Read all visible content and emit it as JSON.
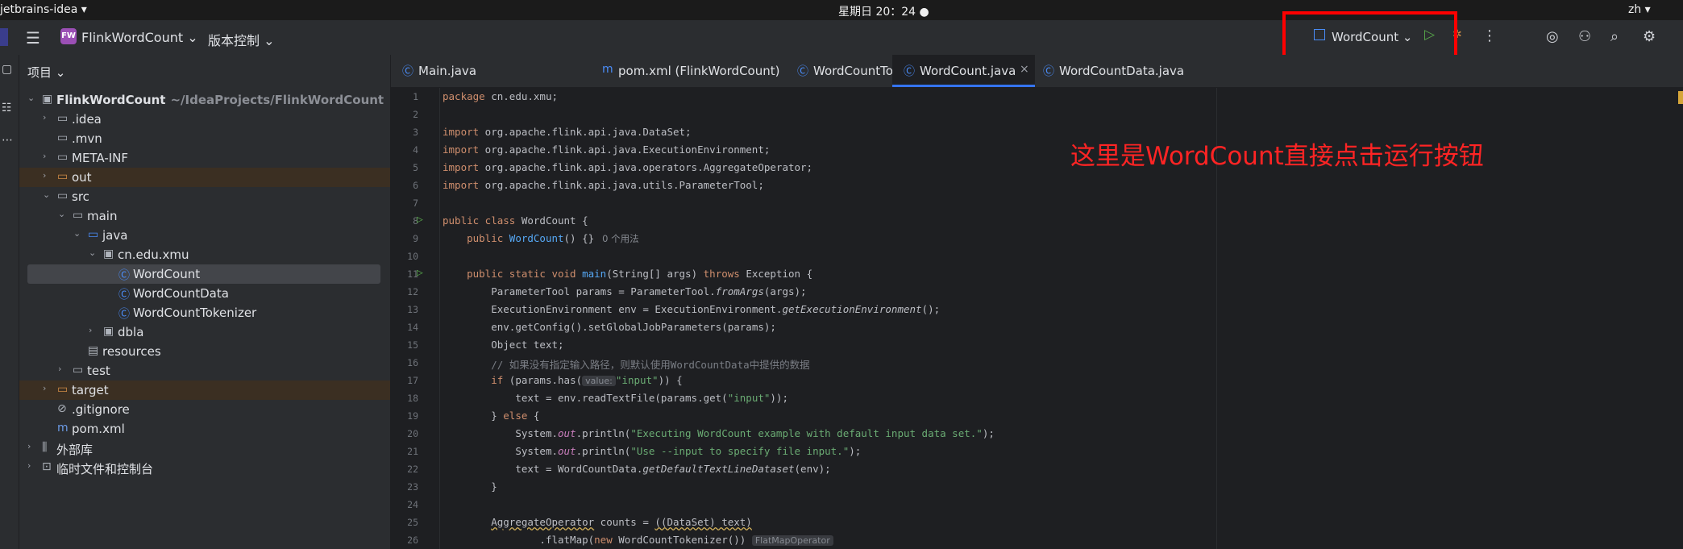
{
  "system_bar": {
    "app_menu": "jetbrains-idea ▾",
    "clock": "星期日 20：24 ●",
    "input_method": "zh ▾"
  },
  "toolbar": {
    "menu_icon": "hamburger-icon",
    "project_badge": "FW",
    "project_name": "FlinkWordCount ⌄",
    "vcs_label": "版本控制 ⌄",
    "run_config": "WordCount ⌄",
    "icons": [
      "copilot-icon",
      "add-user-icon",
      "search-icon",
      "gear-icon"
    ]
  },
  "project_panel": {
    "title": "项目 ⌄",
    "rows": [
      {
        "label": "FlinkWordCount",
        "path": "~/IdeaProjects/FlinkWordCount",
        "depth": 0,
        "arrow": "⌄",
        "icon": "▣"
      },
      {
        "label": ".idea",
        "depth": 1,
        "arrow": "›",
        "icon": "▭"
      },
      {
        "label": ".mvn",
        "depth": 1,
        "arrow": "",
        "icon": "▭"
      },
      {
        "label": "META-INF",
        "depth": 1,
        "arrow": "›",
        "icon": "▭"
      },
      {
        "label": "out",
        "depth": 1,
        "arrow": "›",
        "icon": "▭"
      },
      {
        "label": "src",
        "depth": 1,
        "arrow": "⌄",
        "icon": "▭"
      },
      {
        "label": "main",
        "depth": 2,
        "arrow": "⌄",
        "icon": "▭"
      },
      {
        "label": "java",
        "depth": 3,
        "arrow": "⌄",
        "icon": "▭"
      },
      {
        "label": "cn.edu.xmu",
        "depth": 4,
        "arrow": "⌄",
        "icon": "▣"
      },
      {
        "label": "WordCount",
        "depth": 5,
        "arrow": "",
        "icon": "Ⓒ"
      },
      {
        "label": "WordCountData",
        "depth": 5,
        "arrow": "",
        "icon": "Ⓒ"
      },
      {
        "label": "WordCountTokenizer",
        "depth": 5,
        "arrow": "",
        "icon": "Ⓒ"
      },
      {
        "label": "dbla",
        "depth": 4,
        "arrow": "›",
        "icon": "▣"
      },
      {
        "label": "resources",
        "depth": 3,
        "arrow": "",
        "icon": "▤"
      },
      {
        "label": "test",
        "depth": 2,
        "arrow": "›",
        "icon": "▭"
      },
      {
        "label": "target",
        "depth": 1,
        "arrow": "›",
        "icon": "▭"
      },
      {
        "label": ".gitignore",
        "depth": 1,
        "arrow": "",
        "icon": "⊘"
      },
      {
        "label": "pom.xml",
        "depth": 1,
        "arrow": "",
        "icon": "m"
      },
      {
        "label": "外部库",
        "depth": 0,
        "arrow": "›",
        "icon": "⫼"
      },
      {
        "label": "临时文件和控制台",
        "depth": 0,
        "arrow": "›",
        "icon": "⊡"
      }
    ]
  },
  "tabs": [
    {
      "label": "Main.java",
      "icon": "Ⓒ"
    },
    {
      "label": "pom.xml (FlinkWordCount)",
      "icon": "m"
    },
    {
      "label": "WordCountTokenizer.java",
      "icon": "Ⓒ"
    },
    {
      "label": "WordCount.java",
      "icon": "Ⓒ",
      "close": "×"
    },
    {
      "label": "WordCountData.java",
      "icon": "Ⓒ"
    }
  ],
  "editor": {
    "line_numbers": [
      "1",
      "2",
      "3",
      "4",
      "5",
      "6",
      "7",
      "8",
      "9",
      "10",
      "11",
      "12",
      "13",
      "14",
      "15",
      "16",
      "17",
      "18",
      "19",
      "20",
      "21",
      "22",
      "23",
      "24",
      "25",
      "26"
    ],
    "code": {
      "l1_kw": "package",
      "l1_rest": " cn.edu.xmu;",
      "l3_kw": "import",
      "l3_rest": " org.apache.flink.api.java.DataSet;",
      "l4_kw": "import",
      "l4_rest": " org.apache.flink.api.java.ExecutionEnvironment;",
      "l5_kw": "import",
      "l5_rest": " org.apache.flink.api.java.operators.AggregateOperator;",
      "l6_kw": "import",
      "l6_rest": " org.apache.flink.api.java.utils.ParameterTool;",
      "l8_kw": "public class",
      "l8_rest": " WordCount {",
      "l9_kw": "public",
      "l9_fn": "WordCount",
      "l9_rest": "() {}",
      "l9_hint": "0 个用法",
      "l11_kw1": "public static void",
      "l11_fn": "main",
      "l11_mid": "(String[] args) ",
      "l11_kw2": "throws",
      "l11_rest": " Exception {",
      "l12_a": "ParameterTool params = ParameterTool.",
      "l12_it": "fromArgs",
      "l12_b": "(args);",
      "l13_a": "ExecutionEnvironment env = ExecutionEnvironment.",
      "l13_it": "getExecutionEnvironment",
      "l13_b": "();",
      "l14": "env.getConfig().setGlobalJobParameters(params);",
      "l15": "Object text;",
      "l16_cm": "// 如果没有指定输入路径，则默认使用WordCountData中提供的数据",
      "l17_kw": "if",
      "l17_a": " (params.has(",
      "l17_chip": "value:",
      "l17_str": "\"input\"",
      "l17_b": ")) {",
      "l18_a": "text = env.readTextFile(params.get(",
      "l18_str": "\"input\"",
      "l18_b": "));",
      "l19_a": "} ",
      "l19_kw": "else",
      "l19_b": " {",
      "l20_a": "System.",
      "l20_st": "out",
      "l20_b": ".println(",
      "l20_str": "\"Executing WordCount example with default input data set.\"",
      "l20_c": ");",
      "l21_a": "System.",
      "l21_st": "out",
      "l21_b": ".println(",
      "l21_str": "\"Use --input to specify file input.\"",
      "l21_c": ");",
      "l22_a": "text = WordCountData.",
      "l22_it": "getDefaultTextLineDataset",
      "l22_b": "(env);",
      "l23": "}",
      "l25_w": "AggregateOperator",
      "l25_a": " counts = ",
      "l25_w2": "((DataSet) text)",
      "l26_a": ".flatMap(",
      "l26_kw": "new",
      "l26_b": " WordCountTokenizer())",
      "l26_chip": "FlatMapOperator"
    }
  },
  "annotation": "这里是WordCount直接点击运行按钮",
  "colors": {
    "annotation_red": "#ff2424",
    "highlight_box": "#ff0000",
    "accent_blue": "#3574f0",
    "run_green": "#57a64a"
  }
}
